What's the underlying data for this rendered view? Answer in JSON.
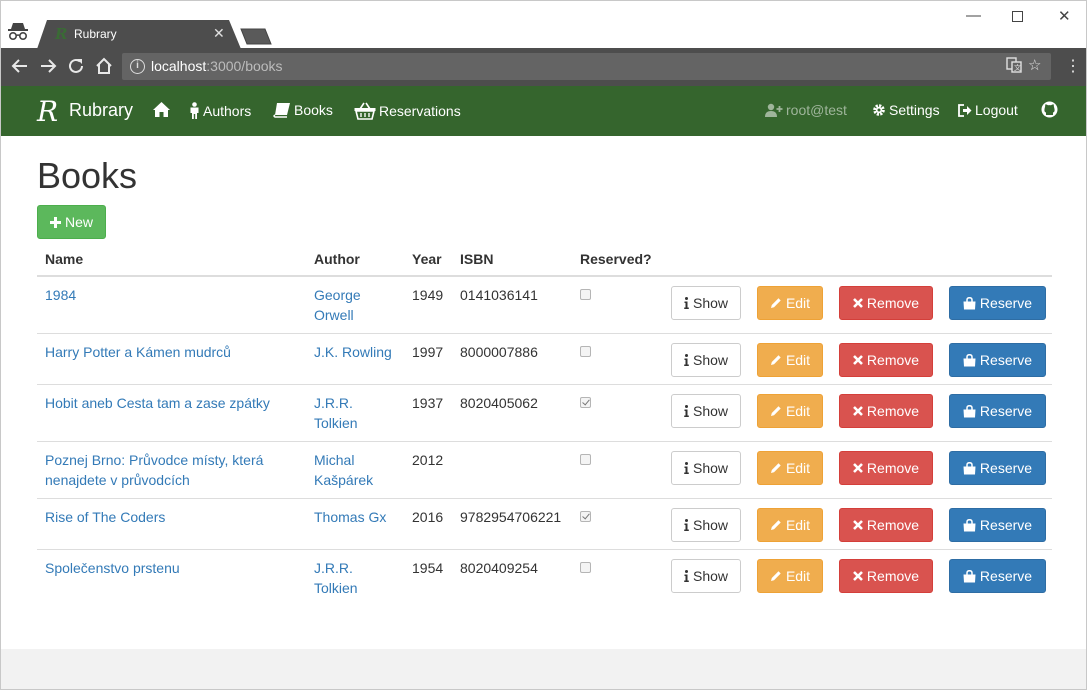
{
  "browser": {
    "tab_title": "Rubrary",
    "favicon_letter": "R",
    "url_host": "localhost",
    "url_path": ":3000/books"
  },
  "navbar": {
    "brand_logo": "R",
    "brand_name": "Rubrary",
    "links": {
      "authors": "Authors",
      "books": "Books",
      "reservations": "Reservations"
    },
    "user": "root@test",
    "settings": "Settings",
    "logout": "Logout"
  },
  "page": {
    "title": "Books",
    "new_button": "New"
  },
  "table": {
    "headers": {
      "name": "Name",
      "author": "Author",
      "year": "Year",
      "isbn": "ISBN",
      "reserved": "Reserved?"
    },
    "rows": [
      {
        "name": "1984",
        "author": "George Orwell",
        "year": "1949",
        "isbn": "0141036141",
        "reserved": false
      },
      {
        "name": "Harry Potter a Kámen mudrců",
        "author": "J.K. Rowling",
        "year": "1997",
        "isbn": "8000007886",
        "reserved": false
      },
      {
        "name": "Hobit aneb Cesta tam a zase zpátky",
        "author": "J.R.R. Tolkien",
        "year": "1937",
        "isbn": "8020405062",
        "reserved": true
      },
      {
        "name": "Poznej Brno: Průvodce místy, která nenajdete v průvodcích",
        "author": "Michal Kašpárek",
        "year": "2012",
        "isbn": "",
        "reserved": false
      },
      {
        "name": "Rise of The Coders",
        "author": "Thomas Gx",
        "year": "2016",
        "isbn": "9782954706221",
        "reserved": true
      },
      {
        "name": "Společenstvo prstenu",
        "author": "J.R.R. Tolkien",
        "year": "1954",
        "isbn": "8020409254",
        "reserved": false
      }
    ],
    "actions": {
      "show": "Show",
      "edit": "Edit",
      "remove": "Remove",
      "reserve": "Reserve"
    }
  },
  "colors": {
    "navbar": "#35652d",
    "new_button": "#5cb85c",
    "edit_button": "#f0ad4e",
    "remove_button": "#d9534f",
    "reserve_button": "#337ab7",
    "link": "#337ab7"
  },
  "icons": [
    "incognito-icon",
    "home-icon",
    "male-icon",
    "book-icon",
    "basket-icon",
    "user-plus-icon",
    "cog-icon",
    "logout-icon",
    "github-icon",
    "plus-icon",
    "info-icon",
    "pencil-icon",
    "remove-icon",
    "bag-icon"
  ]
}
